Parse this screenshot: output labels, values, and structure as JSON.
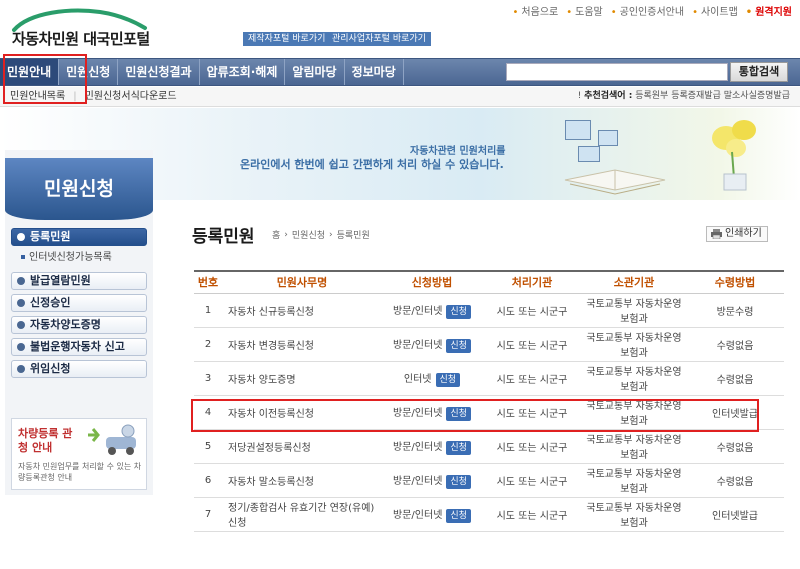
{
  "top_links": {
    "home": "처음으로",
    "help": "도움말",
    "cert": "공인인증서안내",
    "sitemap": "사이트맵",
    "remote": "원격지원"
  },
  "logo": {
    "text": "자동차민원 대국민포털"
  },
  "portal_buttons": {
    "maker": "제작자포털 바로가기",
    "business": "관리사업자포털 바로가기"
  },
  "nav": {
    "items": [
      "민원안내",
      "민원신청",
      "민원신청결과",
      "압류조회·해제",
      "알림마당",
      "정보마당"
    ],
    "search_placeholder": "",
    "search_label": "통합검색"
  },
  "subnav": {
    "items": [
      "민원안내목록",
      "민원신청서식다운로드"
    ],
    "recommend_label": "추천검색어 :",
    "recommend_items": [
      "등록원부",
      "등록증재발급",
      "말소사실증명발급"
    ]
  },
  "banner": {
    "line1": "자동차관련 민원처리를",
    "line2": "온라인에서 한번에 쉽고 간편하게 처리 하실 수 있습니다."
  },
  "sidebar": {
    "title": "민원신청",
    "items": [
      "등록민원",
      "발급열람민원",
      "신정승인",
      "자동차양도증명",
      "불법운행자동차 신고",
      "위임신청"
    ],
    "sub_item": "인터넷신청가능목록",
    "info_title": "차량등록 관청 안내",
    "info_desc": "자동차 민원업무를 처리할 수 있는 차량등록관청 안내"
  },
  "content": {
    "title": "등록민원",
    "breadcrumb": [
      "홈",
      "민원신청",
      "등록민원"
    ],
    "print_label": "인쇄하기",
    "columns": [
      "번호",
      "민원사무명",
      "신청방법",
      "처리기관",
      "소관기관",
      "수령방법"
    ],
    "apply_label": "신청",
    "rows": [
      {
        "no": "1",
        "name": "자동차 신규등록신청",
        "method": "방문/인터넷",
        "agency": "시도 또는 시군구",
        "owner": "국토교통부 자동차운영보험과",
        "receive": "방문수령"
      },
      {
        "no": "2",
        "name": "자동차 변경등록신청",
        "method": "방문/인터넷",
        "agency": "시도 또는 시군구",
        "owner": "국토교통부 자동차운영보험과",
        "receive": "수령없음"
      },
      {
        "no": "3",
        "name": "자동차 양도증명",
        "method": "인터넷",
        "agency": "시도 또는 시군구",
        "owner": "국토교통부 자동차운영보험과",
        "receive": "수령없음"
      },
      {
        "no": "4",
        "name": "자동차 이전등록신청",
        "method": "방문/인터넷",
        "agency": "시도 또는 시군구",
        "owner": "국토교통부 자동차운영보험과",
        "receive": "인터넷발급"
      },
      {
        "no": "5",
        "name": "저당권설정등록신청",
        "method": "방문/인터넷",
        "agency": "시도 또는 시군구",
        "owner": "국토교통부 자동차운영보험과",
        "receive": "수령없음"
      },
      {
        "no": "6",
        "name": "자동차 말소등록신청",
        "method": "방문/인터넷",
        "agency": "시도 또는 시군구",
        "owner": "국토교통부 자동차운영보험과",
        "receive": "수령없음"
      },
      {
        "no": "7",
        "name": "정기/종합검사 유효기간 연장(유예)신청",
        "method": "방문/인터넷",
        "agency": "시도 또는 시군구",
        "owner": "국토교통부 자동차운영보험과",
        "receive": "인터넷발급"
      }
    ]
  },
  "colors": {
    "nav": "#4b6692",
    "accent": "#3a6db4",
    "header_text": "#c05000",
    "highlight": "#e02020"
  }
}
